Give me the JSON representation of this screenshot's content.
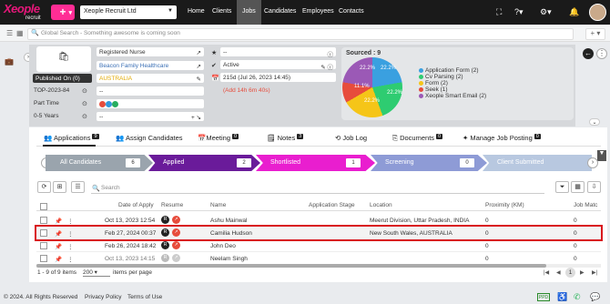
{
  "nav": {
    "logo": "Xeople",
    "logo_sub": "recruit",
    "add_label": "+",
    "org": "Xeople Recruit Ltd",
    "items": [
      "Home",
      "Clients",
      "Jobs",
      "Candidates",
      "Employees",
      "Contacts"
    ],
    "active": "Jobs"
  },
  "search": {
    "placeholder": "Global Search - Something awesome is coming soon"
  },
  "job": {
    "status_published": "Published On (0)",
    "code": "TOP-2023-84",
    "type": "Part Time",
    "years": "0-5 Years",
    "title": "Registered Nurse",
    "client": "Beacon Family Healthcare",
    "location": "AUSTRALIA",
    "blank1": "--",
    "blank2": "--",
    "status": "Active",
    "created": "215d (Jul 26, 2023 14:45)",
    "added": "(Add 14h 6m 40s)",
    "blank3": "--"
  },
  "sourced": {
    "title": "Sourced : 9",
    "legend": [
      {
        "label": "Application Form (2)",
        "color": "#3aa0e0"
      },
      {
        "label": "Cv Parsing (2)",
        "color": "#2ecc71"
      },
      {
        "label": "Form (2)",
        "color": "#f5c518"
      },
      {
        "label": "Seek (1)",
        "color": "#e74c3c"
      },
      {
        "label": "Xeople Smart Email (2)",
        "color": "#9b59b6"
      }
    ],
    "slice_labels": [
      "22.2%",
      "22.2%",
      "22.2%",
      "22.2%",
      "11.1%"
    ]
  },
  "tabs": [
    {
      "label": "Applications",
      "count": "9"
    },
    {
      "label": "Assign Candidates",
      "count": ""
    },
    {
      "label": "Meeting",
      "count": "0"
    },
    {
      "label": "Notes",
      "count": "3"
    },
    {
      "label": "Job Log",
      "count": ""
    },
    {
      "label": "Documents",
      "count": "0"
    },
    {
      "label": "Manage Job Posting",
      "count": "0"
    }
  ],
  "stages": [
    {
      "label": "All Candidates",
      "count": "6"
    },
    {
      "label": "Applied",
      "count": "2"
    },
    {
      "label": "Shortlisted",
      "count": "1"
    },
    {
      "label": "Screening",
      "count": "0"
    },
    {
      "label": "Client Submitted",
      "count": ""
    }
  ],
  "table": {
    "search_placeholder": "Search",
    "columns": [
      "Date of Apply",
      "Resume",
      "Name",
      "Application Stage",
      "Location",
      "Proximity (KM)",
      "Job Matc"
    ],
    "rows": [
      {
        "date": "Oct 13, 2023 12:54",
        "name": "Ashu Mainwal",
        "location": "Meerut Division, Uttar Pradesh, INDIA",
        "proximity": "0",
        "match": "0"
      },
      {
        "date": "Feb 27, 2024 00:37",
        "name": "Camilia Hudson",
        "location": "New South Wales, AUSTRALIA",
        "proximity": "0",
        "match": "0"
      },
      {
        "date": "Feb 26, 2024 18:42",
        "name": "John Deo",
        "location": "",
        "proximity": "0",
        "match": "0"
      },
      {
        "date": "Oct 13, 2023 14:15",
        "name": "Neelam Singh",
        "location": "",
        "proximity": "0",
        "match": "0"
      }
    ]
  },
  "pagination": {
    "summary": "1 - 9 of 9 items",
    "page_size": "200",
    "per_page_label": "items per page",
    "page": "1"
  },
  "footer": {
    "copyright": "© 2024. All Rights Reserved",
    "privacy": "Privacy Policy",
    "terms": "Terms of Use",
    "badge": "PPD"
  }
}
